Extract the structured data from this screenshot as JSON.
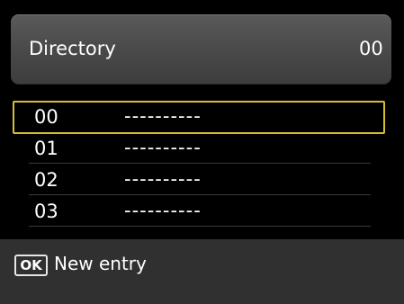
{
  "header": {
    "title": "Directory",
    "code": "00"
  },
  "entries": [
    {
      "number": "00",
      "value": "----------",
      "selected": true
    },
    {
      "number": "01",
      "value": "----------",
      "selected": false
    },
    {
      "number": "02",
      "value": "----------",
      "selected": false
    },
    {
      "number": "03",
      "value": "----------",
      "selected": false
    }
  ],
  "footer": {
    "key_label": "OK",
    "action_label": "New entry"
  },
  "colors": {
    "selection": "#d6c032",
    "footer_bg": "#303030",
    "header_bg": "#4b4b4b"
  }
}
